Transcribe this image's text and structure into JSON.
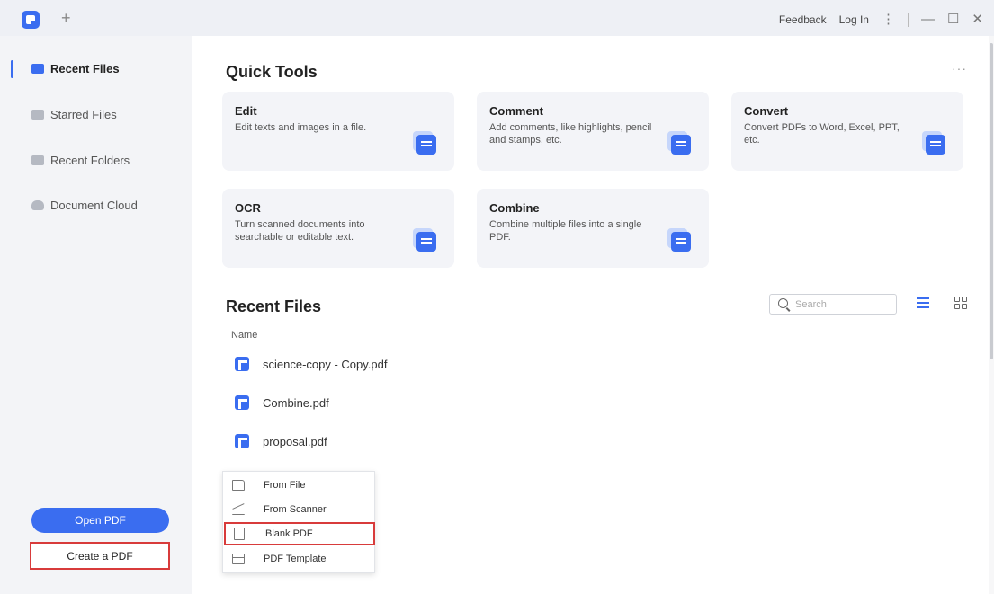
{
  "titlebar": {
    "new_tab": "+",
    "feedback": "Feedback",
    "login": "Log In",
    "more_icon": "⋮",
    "minimize_icon": "—",
    "maximize_icon": "☐",
    "close_icon": "✕"
  },
  "sidebar": {
    "items": [
      {
        "label": "Recent Files",
        "icon": "recent-files-icon",
        "active": true
      },
      {
        "label": "Starred Files",
        "icon": "star-icon",
        "active": false
      },
      {
        "label": "Recent Folders",
        "icon": "folder-icon",
        "active": false
      },
      {
        "label": "Document Cloud",
        "icon": "cloud-icon",
        "active": false
      }
    ],
    "open_pdf": "Open PDF",
    "create_pdf": "Create a PDF"
  },
  "quick_tools": {
    "title": "Quick Tools",
    "more": "···",
    "cards": [
      {
        "title": "Edit",
        "desc": "Edit texts and images in a file."
      },
      {
        "title": "Comment",
        "desc": "Add comments, like highlights, pencil and stamps, etc."
      },
      {
        "title": "Convert",
        "desc": "Convert PDFs to Word, Excel, PPT, etc."
      },
      {
        "title": "OCR",
        "desc": "Turn scanned documents into searchable or editable text."
      },
      {
        "title": "Combine",
        "desc": "Combine multiple files into a single PDF."
      }
    ]
  },
  "recent": {
    "title": "Recent Files",
    "search_placeholder": "Search",
    "column_name": "Name",
    "files": [
      "science-copy - Copy.pdf",
      "Combine.pdf",
      "proposal.pdf"
    ]
  },
  "create_menu": {
    "items": [
      {
        "label": "From File",
        "icon": "folder-icon"
      },
      {
        "label": "From Scanner",
        "icon": "scanner-icon"
      },
      {
        "label": "Blank PDF",
        "icon": "blank-page-icon"
      },
      {
        "label": "PDF Template",
        "icon": "template-icon"
      }
    ]
  },
  "colors": {
    "accent": "#3a6df0",
    "highlight_border": "#d83b3b",
    "sidebar_bg": "#f3f4f7",
    "card_bg": "#f3f4f8"
  }
}
